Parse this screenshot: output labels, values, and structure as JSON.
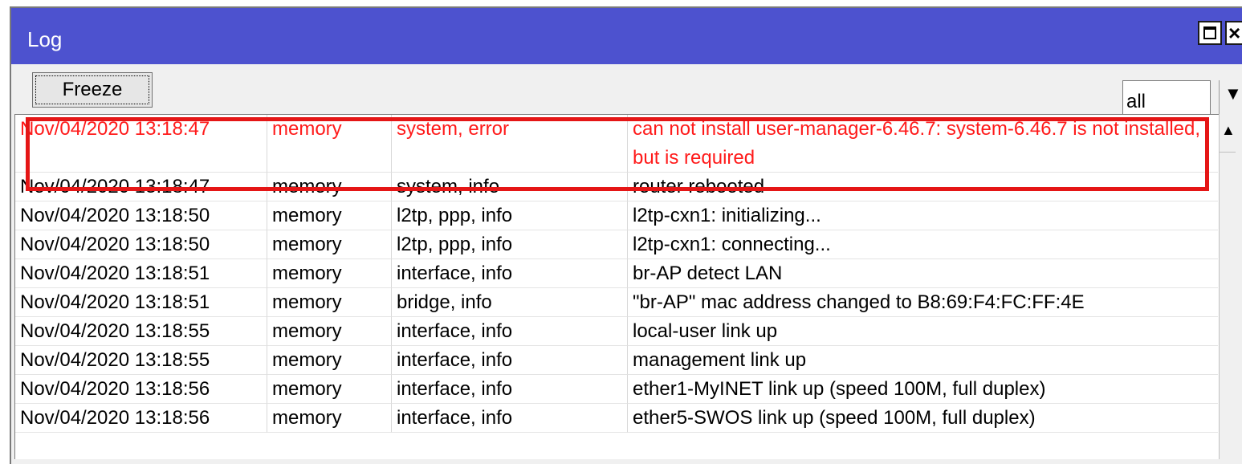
{
  "window": {
    "title": "Log"
  },
  "toolbar": {
    "freeze_label": "Freeze",
    "filter_value": "all"
  },
  "log_entries": [
    {
      "time": "Nov/04/2020 13:18:47",
      "buffer": "memory",
      "topics": "system, error",
      "message": "can not install user-manager-6.46.7: system-6.46.7 is not installed, but is required",
      "level": "error"
    },
    {
      "time": "Nov/04/2020 13:18:47",
      "buffer": "memory",
      "topics": "system, info",
      "message": "router rebooted",
      "level": "info"
    },
    {
      "time": "Nov/04/2020 13:18:50",
      "buffer": "memory",
      "topics": "l2tp, ppp, info",
      "message": "l2tp-cxn1: initializing...",
      "level": "info"
    },
    {
      "time": "Nov/04/2020 13:18:50",
      "buffer": "memory",
      "topics": "l2tp, ppp, info",
      "message": "l2tp-cxn1: connecting...",
      "level": "info"
    },
    {
      "time": "Nov/04/2020 13:18:51",
      "buffer": "memory",
      "topics": "interface, info",
      "message": "br-AP detect LAN",
      "level": "info"
    },
    {
      "time": "Nov/04/2020 13:18:51",
      "buffer": "memory",
      "topics": "bridge, info",
      "message": "\"br-AP\" mac address changed to B8:69:F4:FC:FF:4E",
      "level": "info"
    },
    {
      "time": "Nov/04/2020 13:18:55",
      "buffer": "memory",
      "topics": "interface, info",
      "message": "local-user link up",
      "level": "info"
    },
    {
      "time": "Nov/04/2020 13:18:55",
      "buffer": "memory",
      "topics": "interface, info",
      "message": "management link up",
      "level": "info"
    },
    {
      "time": "Nov/04/2020 13:18:56",
      "buffer": "memory",
      "topics": "interface, info",
      "message": "ether1-MyINET link up (speed 100M, full duplex)",
      "level": "info"
    },
    {
      "time": "Nov/04/2020 13:18:56",
      "buffer": "memory",
      "topics": "interface, info",
      "message": "ether5-SWOS link up (speed 100M, full duplex)",
      "level": "info"
    }
  ],
  "colors": {
    "titlebar": "#4d52cf",
    "error_text": "#ff1a1a",
    "highlight": "#e51616"
  }
}
